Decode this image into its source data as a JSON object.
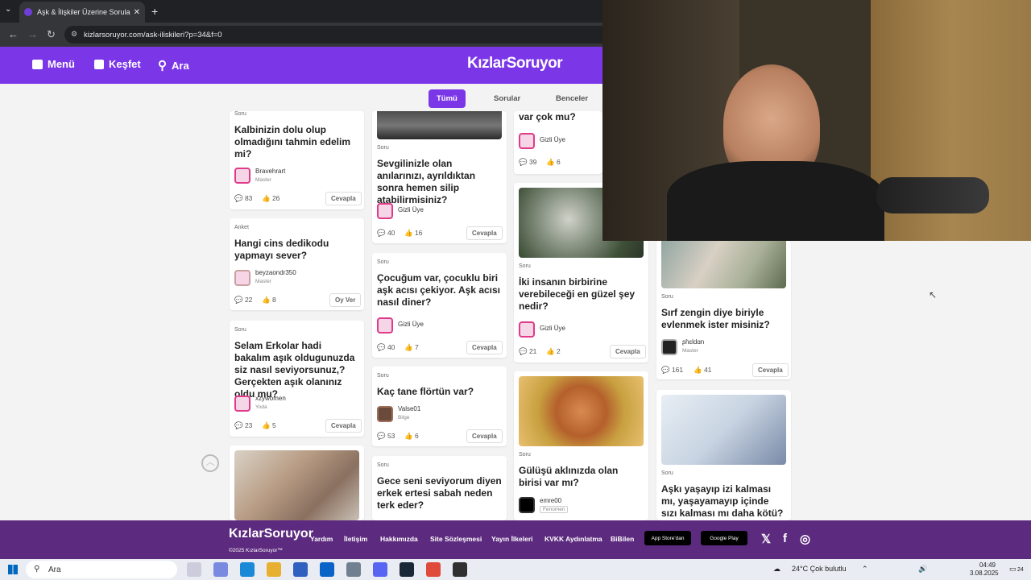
{
  "browser": {
    "tab_title": "Aşk & İlişkiler Üzerine Sorular -",
    "url": "kizlarsoruyor.com/ask-iliskileri?p=34&f=0"
  },
  "header": {
    "menu": "Menü",
    "explore": "Keşfet",
    "search": "Ara",
    "logo": "KızlarSoruyor"
  },
  "filters": {
    "all": "Tümü",
    "questions": "Sorular",
    "opinions": "Benceler"
  },
  "cards": [
    {
      "type": "Soru",
      "title": "Kalbinizin dolu olup olmadığını tahmin edelim mi?",
      "user": "Bravehrart",
      "rank": "Master",
      "comments": "83",
      "likes": "26",
      "action": "Cevapla"
    },
    {
      "type": "Anket",
      "title": "Hangi cins dedikodu yapmayı sever?",
      "user": "beyzaondr350",
      "rank": "Master",
      "comments": "22",
      "likes": "8",
      "action": "Oy Ver"
    },
    {
      "type": "Soru",
      "title": "Selam Erkolar hadi bakalım aşık oldugunuzda siz nasıl seviyorsunuz,? Gerçekten aşık olanınız oldu mu?",
      "user": "xzywomen",
      "rank": "Yoda",
      "comments": "23",
      "likes": "5",
      "action": "Cevapla"
    },
    {
      "type": "Soru",
      "title": "Sevgilinizle olan anılarınızı, ayrıldıktan sonra hemen silip atabilirmisiniz?",
      "user": "Gizli Üye",
      "comments": "40",
      "likes": "16",
      "action": "Cevapla"
    },
    {
      "type": "Soru",
      "title": "Çocuğum var, çocuklu biri aşk acısı çekiyor. Aşk acısı nasıl diner?",
      "user": "Gizli Üye",
      "comments": "40",
      "likes": "7",
      "action": "Cevapla"
    },
    {
      "type": "Soru",
      "title": "Kaç tane flörtün var?",
      "user": "Valse01",
      "rank": "Bilge",
      "comments": "53",
      "likes": "6",
      "action": "Cevapla"
    },
    {
      "type": "Soru",
      "title": "Gece seni seviyorum diyen erkek ertesi sabah neden terk eder?"
    },
    {
      "title": "var çok mu?",
      "user": "Gizli Üye",
      "comments": "39",
      "likes": "6"
    },
    {
      "type": "Soru",
      "title": "İki insanın birbirine verebileceği en güzel şey nedir?",
      "user": "Gizli Üye",
      "comments": "21",
      "likes": "2",
      "action": "Cevapla"
    },
    {
      "type": "Soru",
      "title": "Gülüşü aklınızda olan birisi var mı?",
      "user": "emre00",
      "rank": "Fenomen"
    },
    {
      "type": "Soru",
      "title": "Sırf zengin diye biriyle evlenmek ister misiniz?",
      "user": "ʂɦɛldɑn",
      "rank": "Master",
      "comments": "161",
      "likes": "41",
      "action": "Cevapla"
    },
    {
      "type": "Soru",
      "title": "Aşkı yaşayıp izi kalması mı, yaşayamayıp içinde sızı kalması mı daha kötü?"
    }
  ],
  "footer": {
    "logo": "KızlarSoruyor",
    "copyright": "©2025 KızlarSoruyor™",
    "links": [
      "Yardım",
      "İletişim",
      "Hakkımızda",
      "Site Sözleşmesi",
      "Yayın İlkeleri",
      "KVKK Aydınlatma",
      "BiBilen"
    ],
    "appstore": "App Store'dan",
    "googleplay": "Google Play"
  },
  "taskbar": {
    "search": "Ara",
    "weather": "24°C  Çok bulutlu",
    "time": "04:49",
    "date": "3.08.2025",
    "notif": "24"
  },
  "colors": {
    "brand": "#7b36e8",
    "footer": "#5c2a7e"
  }
}
